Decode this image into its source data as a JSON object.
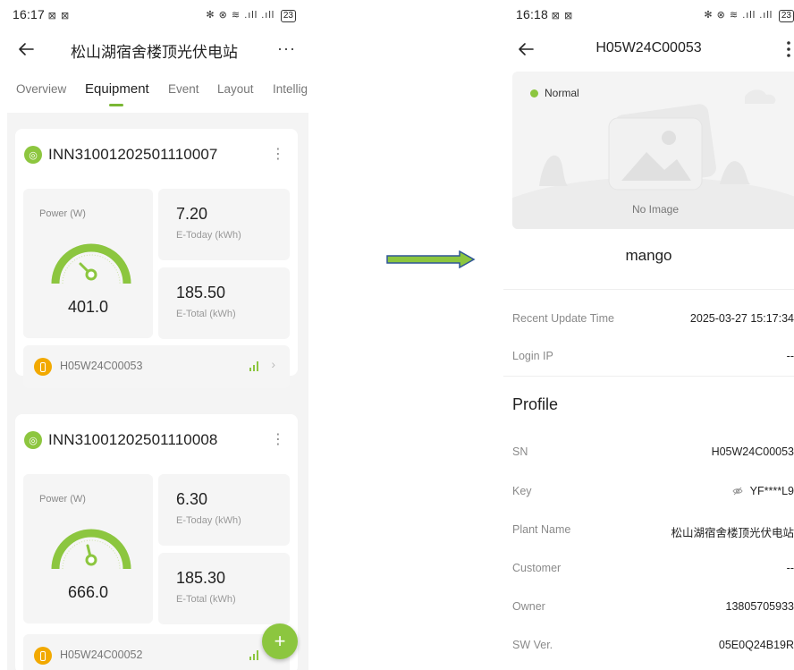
{
  "left_screen": {
    "status_bar": {
      "time": "16:17",
      "indicators": "⊠ ⊠",
      "right_icons": "✻ ⊗ ≋ .ıll .ıll",
      "battery": "23"
    },
    "header": {
      "title": "松山湖宿舍楼顶光伏电站",
      "more_label": "···"
    },
    "tabs": [
      {
        "label": "Overview",
        "active": false
      },
      {
        "label": "Equipment",
        "active": true
      },
      {
        "label": "Event",
        "active": false
      },
      {
        "label": "Layout",
        "active": false
      },
      {
        "label": "Intellig",
        "active": false
      }
    ],
    "devices": [
      {
        "name": "INN31001202501110007",
        "power_label": "Power (W)",
        "power_value": "401.0",
        "today_value": "7.20",
        "today_unit": "E-Today (kWh)",
        "total_value": "185.50",
        "total_unit": "E-Total (kWh)",
        "collector_sn": "H05W24C00053"
      },
      {
        "name": "INN31001202501110008",
        "power_label": "Power (W)",
        "power_value": "666.0",
        "today_value": "6.30",
        "today_unit": "E-Today (kWh)",
        "total_value": "185.30",
        "total_unit": "E-Total (kWh)",
        "collector_sn": "H05W24C00052"
      }
    ],
    "fab_label": "+"
  },
  "right_screen": {
    "status_bar": {
      "time": "16:18",
      "indicators": "⊠ ⊠",
      "right_icons": "✻ ⊗ ≋ .ıll .ıll",
      "battery": "23"
    },
    "header": {
      "title": "H05W24C00053"
    },
    "status_label": "Normal",
    "no_image_text": "No Image",
    "alias": "mango",
    "info_rows": [
      {
        "label": "Recent Update Time",
        "value": "2025-03-27 15:17:34"
      },
      {
        "label": "Login IP",
        "value": "--"
      }
    ],
    "profile_heading": "Profile",
    "profile_rows": [
      {
        "label": "SN",
        "value": "H05W24C00053"
      },
      {
        "label": "Key",
        "value": "YF****L9"
      },
      {
        "label": "Plant Name",
        "value": "松山湖宿舍楼顶光伏电站"
      },
      {
        "label": "Customer",
        "value": "--"
      },
      {
        "label": "Owner",
        "value": "13805705933"
      },
      {
        "label": "SW Ver.",
        "value": "05E0Q24B19R"
      }
    ]
  },
  "colors": {
    "accent": "#8cc63f",
    "collector": "#f2a900",
    "arrow_fill": "#8cc63f",
    "arrow_stroke": "#2f5597"
  },
  "icons": [
    "back-arrow-icon",
    "more-icon",
    "inverter-icon",
    "collector-icon",
    "signal-icon",
    "chevron-right-icon",
    "add-icon",
    "no-image-icon",
    "eye-off-icon",
    "flow-arrow-icon"
  ]
}
